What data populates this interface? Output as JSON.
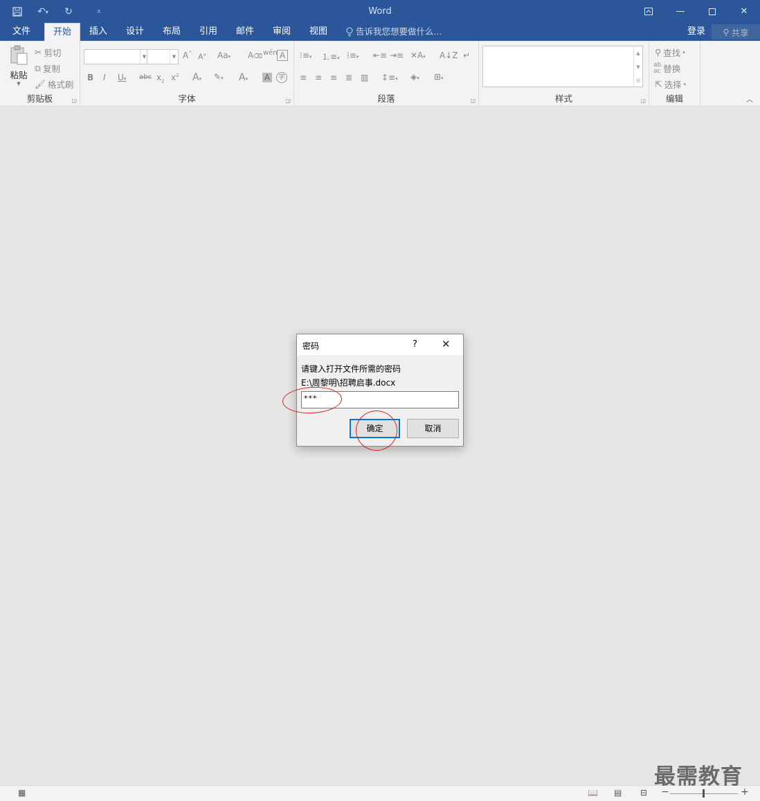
{
  "window": {
    "title": "Word"
  },
  "qat": {
    "save_icon": "save-icon",
    "undo_icon": "undo-icon",
    "redo_icon": "redo-icon",
    "customize_icon": "customize-qat-icon"
  },
  "tabs": [
    "文件",
    "开始",
    "插入",
    "设计",
    "布局",
    "引用",
    "邮件",
    "审阅",
    "视图"
  ],
  "active_tab": "开始",
  "tell_me": "告诉我您想要做什么...",
  "account": {
    "login": "登录",
    "share": "共享"
  },
  "ribbon": {
    "clipboard": {
      "paste": "粘贴",
      "cut": "剪切",
      "copy": "复制",
      "format_painter": "格式刷",
      "label": "剪贴板"
    },
    "font": {
      "label": "字体"
    },
    "paragraph": {
      "label": "段落"
    },
    "styles": {
      "label": "样式"
    },
    "editing": {
      "find": "查找",
      "replace": "替换",
      "select": "选择",
      "label": "编辑"
    }
  },
  "dialog": {
    "title": "密码",
    "help": "?",
    "prompt": "请键入打开文件所需的密码",
    "path": "E:\\周黎明\\招聘启事.docx",
    "password_value": "***",
    "ok": "确定",
    "cancel": "取消"
  },
  "annotation_color": "#e02020",
  "accent": "#2b579a",
  "watermark": "最需教育"
}
